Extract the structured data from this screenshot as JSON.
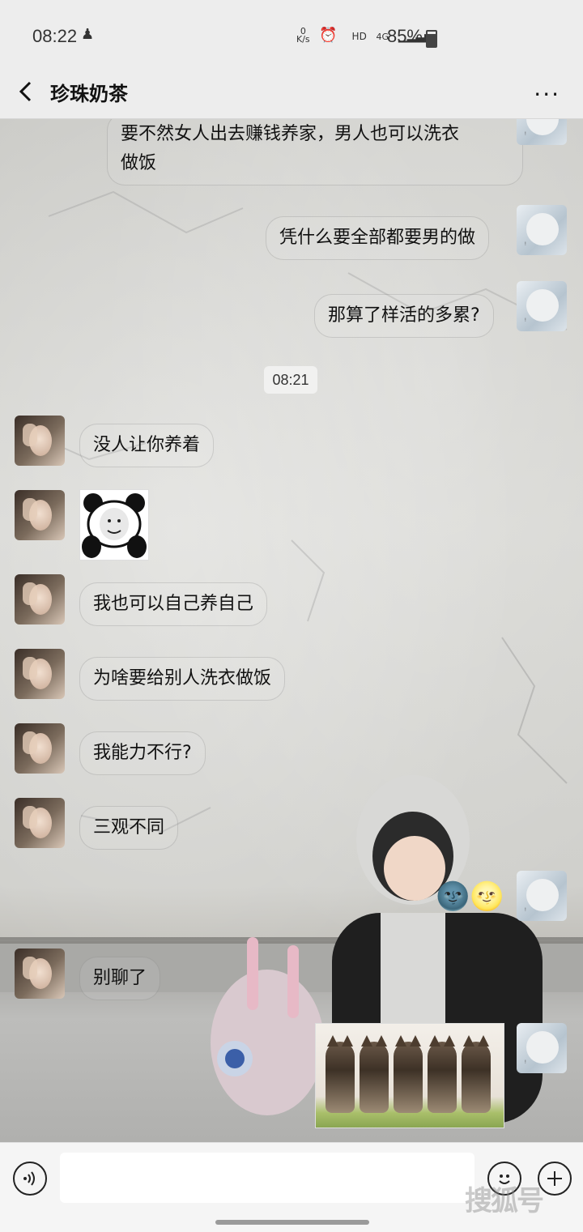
{
  "status_bar": {
    "time": "08:22",
    "network_speed": "0\nK/s",
    "hd": "HD",
    "network": "4G",
    "battery": "85%"
  },
  "header": {
    "title": "珍珠奶茶",
    "back_icon": "chevron-left-icon",
    "more_label": "···"
  },
  "messages": [
    {
      "side": "self",
      "text": "要不然女人出去赚钱养家，男人也可以洗衣\n做饭"
    },
    {
      "side": "self",
      "text": "凭什么要全部都要男的做"
    },
    {
      "side": "self",
      "text": "那算了样活的多累?"
    },
    {
      "type": "time",
      "text": "08:21"
    },
    {
      "side": "other",
      "text": "没人让你养着"
    },
    {
      "side": "other",
      "type": "sticker",
      "sticker": "panda-face-sticker"
    },
    {
      "side": "other",
      "text": "我也可以自己养自己"
    },
    {
      "side": "other",
      "text": "为啥要给别人洗衣做饭"
    },
    {
      "side": "other",
      "text": "我能力不行?"
    },
    {
      "side": "other",
      "text": "三观不同"
    },
    {
      "side": "self",
      "type": "emoji",
      "text": "🌚🌝"
    },
    {
      "side": "other",
      "text": "别聊了"
    },
    {
      "side": "self",
      "type": "sticker",
      "sticker": "five-kittens-sticker"
    }
  ],
  "input_bar": {
    "voice_icon": "voice-icon",
    "emoji_icon": "emoji-icon",
    "plus_icon": "plus-icon",
    "placeholder": ""
  },
  "watermark": "搜狐号"
}
